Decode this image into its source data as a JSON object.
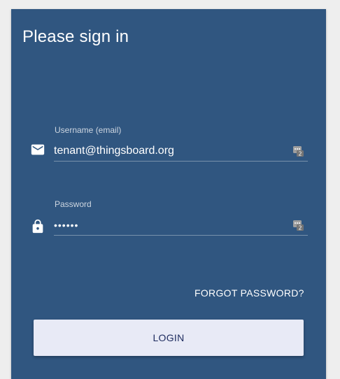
{
  "login_card": {
    "title": "Please sign in",
    "username": {
      "label": "Username (email)",
      "value": "tenant@thingsboard.org",
      "icon": "mail-icon"
    },
    "password": {
      "label": "Password",
      "value": "••••••",
      "icon": "lock-icon"
    },
    "password_manager_icon": "password-manager-icon",
    "forgot_password": "FORGOT PASSWORD?",
    "login_button": "LOGIN"
  },
  "colors": {
    "card_background": "#305680",
    "page_background": "#eeeeee",
    "button_background": "#e8eaf6",
    "button_text": "#1c2a5e"
  }
}
